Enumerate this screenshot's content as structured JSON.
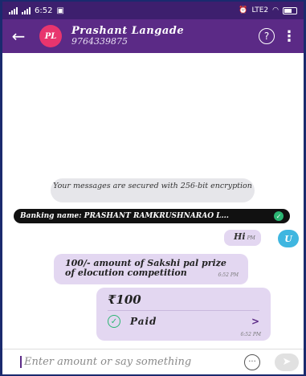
{
  "status_bar": {
    "time": "6:52",
    "network": "LTE2"
  },
  "header": {
    "avatar_initials": "PL",
    "name": "Prashant Langade",
    "phone": "9764339875",
    "help_icon": "?",
    "menu_icon": "⋮"
  },
  "chat": {
    "secure_notice": "Your messages are secured with 256-bit encryption",
    "banking_name": "Banking name: PRASHANT RAMKRUSHNARAO L...",
    "sent_text": "Hi",
    "sent_time": "PM",
    "user_initial": "U",
    "message_text": "100/- amount of Sakshi pal prize of elocution competition",
    "message_time": "6:52 PM",
    "payment": {
      "amount": "₹100",
      "status": "Paid",
      "time": "6:52 PM"
    }
  },
  "input": {
    "placeholder": "Enter amount or say something"
  },
  "colors": {
    "header": "#5b2a86",
    "bubble": "#e3d7f1",
    "avatar": "#e8356e",
    "paid_check": "#2bb673"
  }
}
